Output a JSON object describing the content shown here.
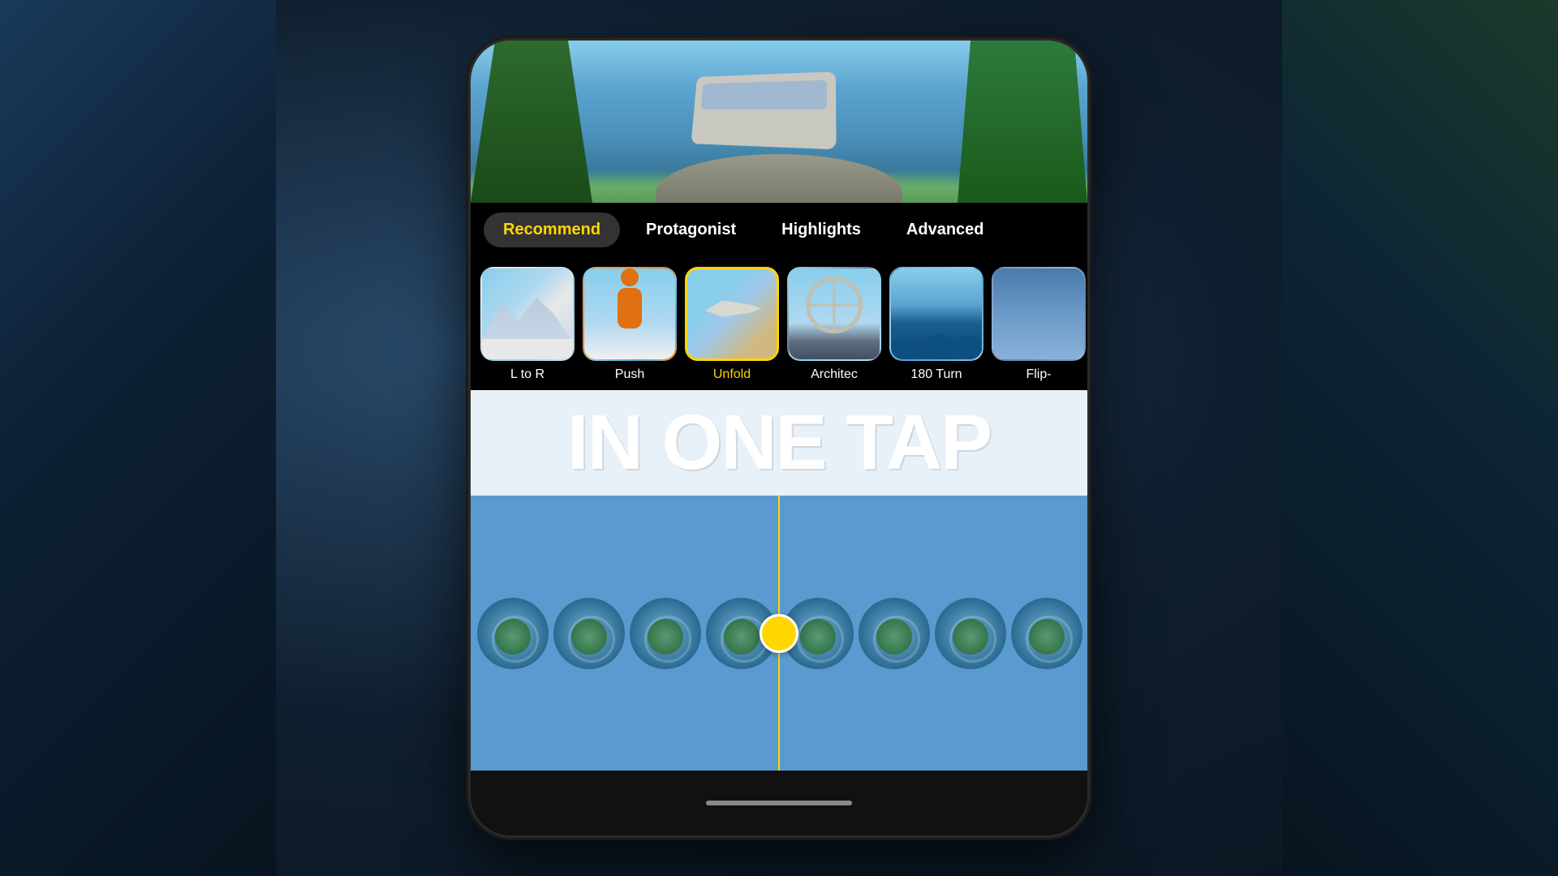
{
  "background": {
    "color": "#1a2a3a"
  },
  "phone": {
    "tabs": [
      {
        "id": "recommend",
        "label": "Recommend",
        "active": true
      },
      {
        "id": "protagonist",
        "label": "Protagonist",
        "active": false
      },
      {
        "id": "highlights",
        "label": "Highlights",
        "active": false
      },
      {
        "id": "advanced",
        "label": "Advanced",
        "active": false
      }
    ],
    "effects": [
      {
        "id": "l-to-r",
        "label": "L to R",
        "selected": false,
        "thumbClass": "thumb-bg-1 thumb-mountain"
      },
      {
        "id": "push",
        "label": "Push",
        "selected": false,
        "thumbClass": "thumb-bg-2"
      },
      {
        "id": "unfold",
        "label": "Unfold",
        "selected": true,
        "thumbClass": "thumb-bg-3"
      },
      {
        "id": "architec",
        "label": "Architec",
        "selected": false,
        "thumbClass": "thumb-bg-4"
      },
      {
        "id": "180-turn",
        "label": "180 Turn",
        "selected": false,
        "thumbClass": "thumb-bg-5"
      },
      {
        "id": "flip",
        "label": "Flip-",
        "selected": false,
        "thumbClass": "thumb-bg-6"
      }
    ],
    "bigText": "IN ONE TAP",
    "homeIndicator": true
  }
}
